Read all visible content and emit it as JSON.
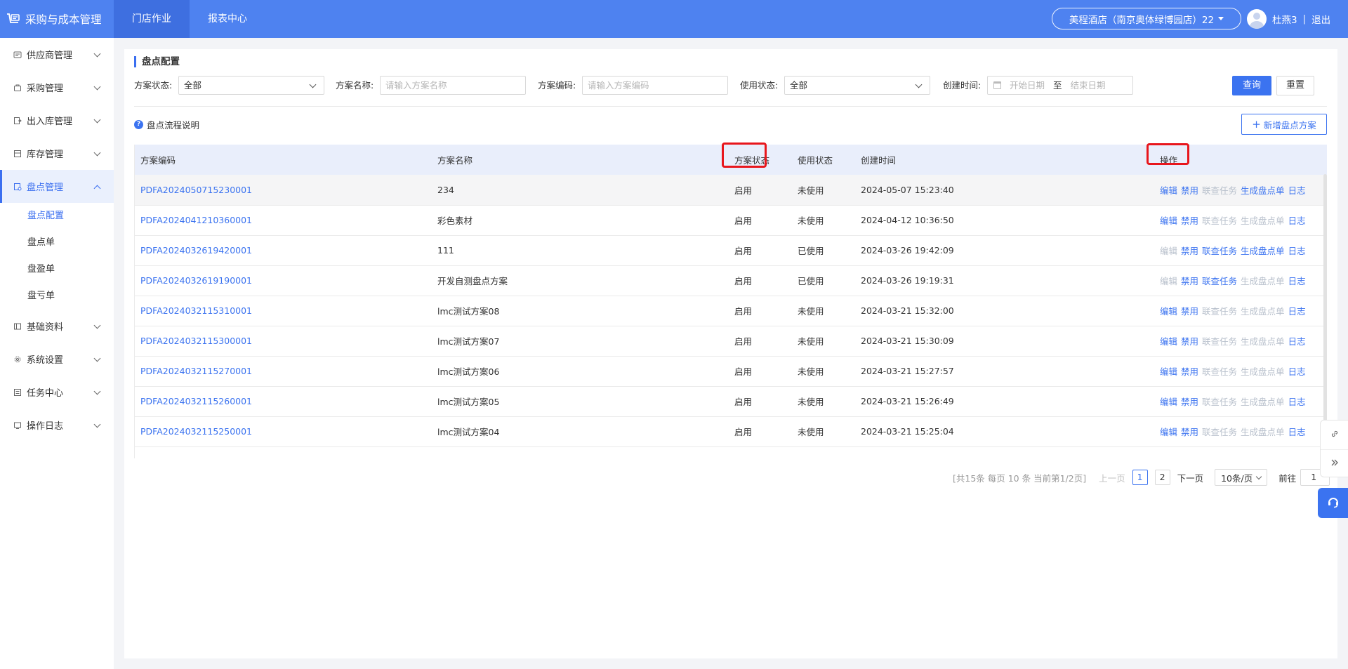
{
  "app": {
    "title": "采购与成本管理"
  },
  "topnav": {
    "tabs": [
      {
        "label": "门店作业"
      },
      {
        "label": "报表中心"
      }
    ]
  },
  "store": {
    "label": "美程酒店（南京奥体绿博园店）22"
  },
  "user": {
    "name": "杜燕3",
    "separator": "|",
    "logout": "退出"
  },
  "sidebar": {
    "groups": [
      {
        "label": "供应商管理",
        "icon": "supplier-icon"
      },
      {
        "label": "采购管理",
        "icon": "purchase-icon"
      },
      {
        "label": "出入库管理",
        "icon": "inout-icon"
      },
      {
        "label": "库存管理",
        "icon": "inventory-icon"
      },
      {
        "label": "盘点管理",
        "icon": "stocktake-icon"
      },
      {
        "label": "基础资料",
        "icon": "basic-data-icon"
      },
      {
        "label": "系统设置",
        "icon": "gear-icon"
      },
      {
        "label": "任务中心",
        "icon": "task-icon"
      },
      {
        "label": "操作日志",
        "icon": "log-icon"
      }
    ],
    "sub_items": [
      {
        "label": "盘点配置"
      },
      {
        "label": "盘点单"
      },
      {
        "label": "盘盈单"
      },
      {
        "label": "盘亏单"
      }
    ]
  },
  "page": {
    "title": "盘点配置"
  },
  "filters": {
    "plan_status": {
      "label": "方案状态:",
      "value": "全部"
    },
    "plan_name": {
      "label": "方案名称:",
      "placeholder": "请输入方案名称"
    },
    "plan_code": {
      "label": "方案编码:",
      "placeholder": "请输入方案编码"
    },
    "use_status": {
      "label": "使用状态:",
      "value": "全部"
    },
    "created_time": {
      "label": "创建时间:",
      "start_placeholder": "开始日期",
      "range_sep": "至",
      "end_placeholder": "结束日期"
    },
    "query_label": "查询",
    "reset_label": "重置"
  },
  "help": {
    "icon_text": "?",
    "label": "盘点流程说明"
  },
  "add_button": {
    "label": "新增盘点方案",
    "icon": "+"
  },
  "table": {
    "headers": [
      "方案编码",
      "方案名称",
      "方案状态",
      "使用状态",
      "创建时间",
      "操作"
    ],
    "rows": [
      {
        "code": "PDFA2024050715230001",
        "name": "234",
        "status": "启用",
        "use": "未使用",
        "time": "2024-05-07 15:23:40",
        "ops": [
          {
            "label": "编辑",
            "enabled": true
          },
          {
            "label": "禁用",
            "enabled": true
          },
          {
            "label": "联查任务",
            "enabled": false
          },
          {
            "label": "生成盘点单",
            "enabled": true
          },
          {
            "label": "日志",
            "enabled": true
          }
        ]
      },
      {
        "code": "PDFA2024041210360001",
        "name": "彩色素材",
        "status": "启用",
        "use": "未使用",
        "time": "2024-04-12 10:36:50",
        "ops": [
          {
            "label": "编辑",
            "enabled": true
          },
          {
            "label": "禁用",
            "enabled": true
          },
          {
            "label": "联查任务",
            "enabled": false
          },
          {
            "label": "生成盘点单",
            "enabled": false
          },
          {
            "label": "日志",
            "enabled": true
          }
        ]
      },
      {
        "code": "PDFA2024032619420001",
        "name": "111",
        "status": "启用",
        "use": "已使用",
        "time": "2024-03-26 19:42:09",
        "ops": [
          {
            "label": "编辑",
            "enabled": false
          },
          {
            "label": "禁用",
            "enabled": true
          },
          {
            "label": "联查任务",
            "enabled": true
          },
          {
            "label": "生成盘点单",
            "enabled": true
          },
          {
            "label": "日志",
            "enabled": true
          }
        ]
      },
      {
        "code": "PDFA2024032619190001",
        "name": "开发自测盘点方案",
        "status": "启用",
        "use": "已使用",
        "time": "2024-03-26 19:19:31",
        "ops": [
          {
            "label": "编辑",
            "enabled": false
          },
          {
            "label": "禁用",
            "enabled": true
          },
          {
            "label": "联查任务",
            "enabled": true
          },
          {
            "label": "生成盘点单",
            "enabled": false
          },
          {
            "label": "日志",
            "enabled": true
          }
        ]
      },
      {
        "code": "PDFA2024032115310001",
        "name": "lmc测试方案08",
        "status": "启用",
        "use": "未使用",
        "time": "2024-03-21 15:32:00",
        "ops": [
          {
            "label": "编辑",
            "enabled": true
          },
          {
            "label": "禁用",
            "enabled": true
          },
          {
            "label": "联查任务",
            "enabled": false
          },
          {
            "label": "生成盘点单",
            "enabled": false
          },
          {
            "label": "日志",
            "enabled": true
          }
        ]
      },
      {
        "code": "PDFA2024032115300001",
        "name": "lmc测试方案07",
        "status": "启用",
        "use": "未使用",
        "time": "2024-03-21 15:30:09",
        "ops": [
          {
            "label": "编辑",
            "enabled": true
          },
          {
            "label": "禁用",
            "enabled": true
          },
          {
            "label": "联查任务",
            "enabled": false
          },
          {
            "label": "生成盘点单",
            "enabled": false
          },
          {
            "label": "日志",
            "enabled": true
          }
        ]
      },
      {
        "code": "PDFA2024032115270001",
        "name": "lmc测试方案06",
        "status": "启用",
        "use": "未使用",
        "time": "2024-03-21 15:27:57",
        "ops": [
          {
            "label": "编辑",
            "enabled": true
          },
          {
            "label": "禁用",
            "enabled": true
          },
          {
            "label": "联查任务",
            "enabled": false
          },
          {
            "label": "生成盘点单",
            "enabled": false
          },
          {
            "label": "日志",
            "enabled": true
          }
        ]
      },
      {
        "code": "PDFA2024032115260001",
        "name": "lmc测试方案05",
        "status": "启用",
        "use": "未使用",
        "time": "2024-03-21 15:26:49",
        "ops": [
          {
            "label": "编辑",
            "enabled": true
          },
          {
            "label": "禁用",
            "enabled": true
          },
          {
            "label": "联查任务",
            "enabled": false
          },
          {
            "label": "生成盘点单",
            "enabled": false
          },
          {
            "label": "日志",
            "enabled": true
          }
        ]
      },
      {
        "code": "PDFA2024032115250001",
        "name": "lmc测试方案04",
        "status": "启用",
        "use": "未使用",
        "time": "2024-03-21 15:25:04",
        "ops": [
          {
            "label": "编辑",
            "enabled": true
          },
          {
            "label": "禁用",
            "enabled": true
          },
          {
            "label": "联查任务",
            "enabled": false
          },
          {
            "label": "生成盘点单",
            "enabled": false
          },
          {
            "label": "日志",
            "enabled": true
          }
        ]
      }
    ]
  },
  "pagination": {
    "summary": "[共15条 每页 10 条 当前第1/2页]",
    "prev": "上一页",
    "pages": [
      "1",
      "2"
    ],
    "next": "下一页",
    "page_size": "10条/页",
    "goto_label": "前往",
    "goto_value": "1"
  },
  "colors": {
    "primary": "#3b73f0",
    "topbar": "#4e82f0",
    "highlight": "#e8161c",
    "disabled_link": "#b8c0cc"
  }
}
